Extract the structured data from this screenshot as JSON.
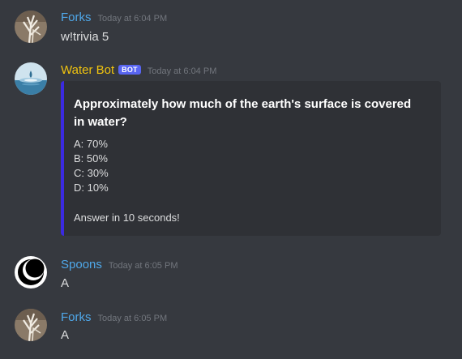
{
  "messages": [
    {
      "author": "Forks",
      "author_color": "#4fa8ea",
      "timestamp": "Today at 6:04 PM",
      "text": "w!trivia 5",
      "avatar": "driftwood-avatar"
    },
    {
      "author": "Water Bot",
      "author_color": "#f1c40f",
      "bot_tag": "BOT",
      "timestamp": "Today at 6:04 PM",
      "avatar": "water-droplet-avatar",
      "embed": {
        "accent_color": "#3b2ae0",
        "title": "Approximately how much of the earth's surface is covered in water?",
        "options": [
          "A: 70%",
          "B: 50%",
          "C: 30%",
          "D: 10%"
        ],
        "footer": "Answer in 10 seconds!"
      }
    },
    {
      "author": "Spoons",
      "author_color": "#4fa8ea",
      "timestamp": "Today at 6:05 PM",
      "text": "A",
      "avatar": "crescent-moon-avatar"
    },
    {
      "author": "Forks",
      "author_color": "#4fa8ea",
      "timestamp": "Today at 6:05 PM",
      "text": "A",
      "avatar": "driftwood-avatar"
    }
  ]
}
